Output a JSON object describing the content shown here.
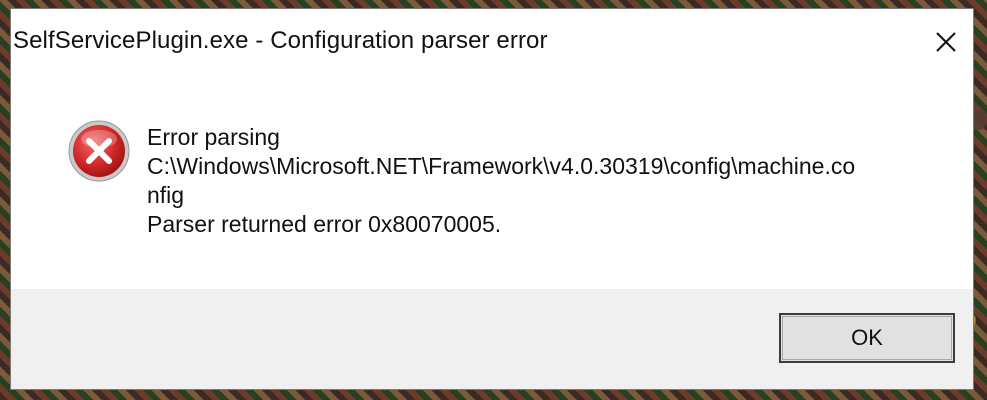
{
  "dialog": {
    "title": "SelfServicePlugin.exe - Configuration parser error",
    "close_icon": "close-icon",
    "error_icon": "error-icon",
    "message_lines": [
      "Error parsing",
      "C:\\Windows\\Microsoft.NET\\Framework\\v4.0.30319\\config\\machine.co",
      "nfig",
      "Parser returned error 0x80070005."
    ],
    "ok_label": "OK"
  },
  "colors": {
    "error_red": "#d42b2b",
    "footer_bg": "#f0f0f0",
    "button_bg": "#e1e1e1",
    "button_border": "#3c3c3c"
  }
}
